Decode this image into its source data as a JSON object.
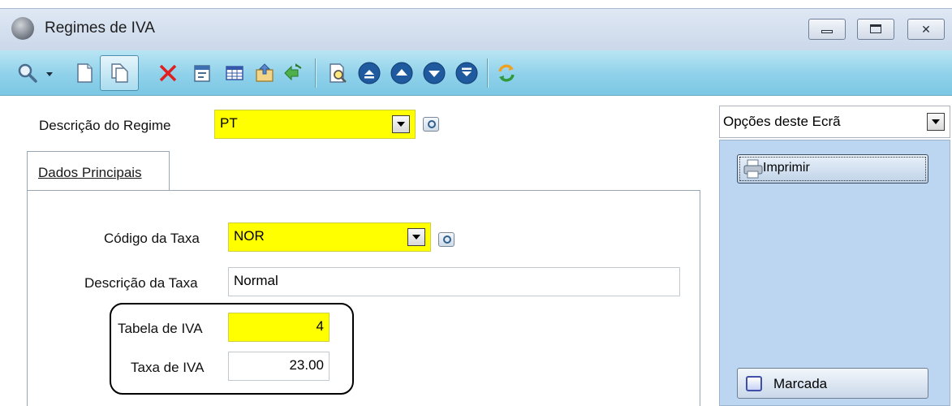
{
  "window": {
    "title": "Regimes de IVA",
    "controls": {
      "minimize": "minimize",
      "maximize": "maximize",
      "close": "close"
    }
  },
  "toolbar": {
    "icons": [
      "search-icon",
      "new-document-icon",
      "copy-document-icon",
      "delete-icon",
      "properties-icon",
      "grid-icon",
      "export-icon",
      "import-icon",
      "print-preview-icon",
      "first-record-icon",
      "previous-record-icon",
      "next-record-icon",
      "last-record-icon",
      "refresh-icon"
    ],
    "colors": {
      "bar": "#8fd1ea",
      "nav_button": "#1f5a9e",
      "delete": "#e02020"
    }
  },
  "form": {
    "regime_label": "Descrição do Regime",
    "regime_value": "PT",
    "tab_label": "Dados Principais",
    "codigo_taxa_label": "Código da Taxa",
    "codigo_taxa_value": "NOR",
    "descricao_taxa_label": "Descrição da Taxa",
    "descricao_taxa_value": "Normal",
    "tabela_iva_label": "Tabela de IVA",
    "tabela_iva_value": "4",
    "taxa_iva_label": "Taxa de IVA",
    "taxa_iva_value": "23.00",
    "required_color": "#ffff00"
  },
  "side_panel": {
    "options_label": "Opções deste Ecrã",
    "print_button": "Imprimir",
    "marked_button": "Marcada",
    "panel_color": "#bcd6f1"
  }
}
